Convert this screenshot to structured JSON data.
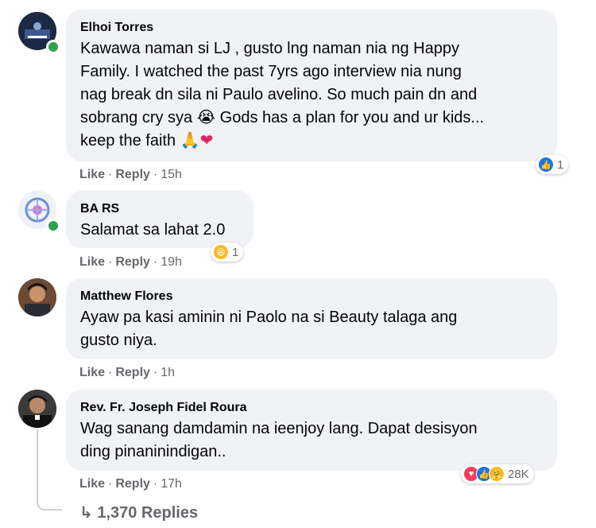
{
  "comments": [
    {
      "author": "Elhoi Torres",
      "lines": [
        "Kawawa naman si LJ , gusto lng naman nia ng Happy",
        "Family. I watched the past 7yrs ago interview nia nung",
        "nag break dn sila ni Paulo avelino. So much pain dn and",
        "sobrang cry sya",
        "Gods has a plan for you and ur kids...",
        "keep the faith"
      ],
      "like_label": "Like",
      "reply_label": "Reply",
      "time": "15h",
      "reaction_count": "1"
    },
    {
      "author": "BA RS",
      "lines": [
        "Salamat sa lahat 2.0"
      ],
      "like_label": "Like",
      "reply_label": "Reply",
      "time": "19h",
      "reaction_count": "1"
    },
    {
      "author": "Matthew Flores",
      "lines": [
        "Ayaw pa kasi aminin ni Paolo na si Beauty talaga ang",
        "gusto niya."
      ],
      "like_label": "Like",
      "reply_label": "Reply",
      "time": "1h"
    },
    {
      "author": "Rev. Fr. Joseph Fidel Roura",
      "lines": [
        "Wag sanang damdamin na ieenjoy lang. Dapat desisyon",
        "ding pinaninindigan.."
      ],
      "like_label": "Like",
      "reply_label": "Reply",
      "time": "17h",
      "reaction_count": "28K"
    }
  ],
  "replies_link": "↳ 1,370 Replies",
  "separator": "·",
  "icons": {
    "like": "like-icon",
    "haha": "haha-icon",
    "love": "love-icon",
    "care": "care-icon",
    "crying": "crying-emoji",
    "pray": "pray-emoji",
    "heart": "heart-emoji"
  },
  "colors": {
    "bubble": "#f0f2f5",
    "meta": "#65676b",
    "like_blue": "#1b74e4",
    "online": "#31a24c"
  }
}
